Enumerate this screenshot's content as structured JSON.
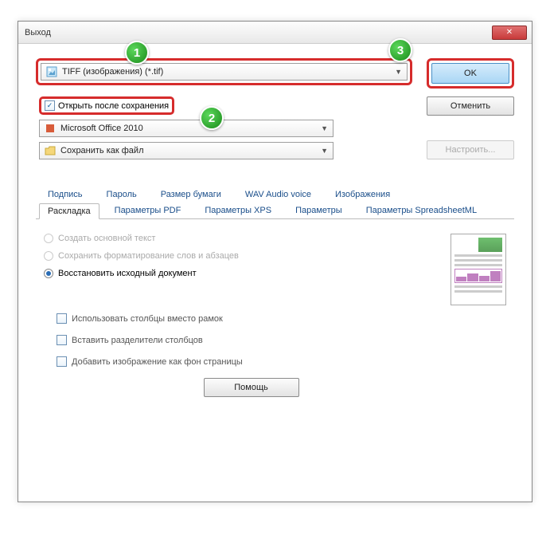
{
  "window": {
    "title": "Выход"
  },
  "markers": {
    "m1": "1",
    "m2": "2",
    "m3": "3"
  },
  "dropdowns": {
    "format": "TIFF (изображения) (*.tif)",
    "app": "Microsoft Office 2010",
    "save": "Сохранить как файл"
  },
  "buttons": {
    "ok": "OK",
    "cancel": "Отменить",
    "configure": "Настроить...",
    "help": "Помощь"
  },
  "checkboxes": {
    "open_after": "Открыть после сохранения",
    "use_columns": "Использовать столбцы вместо рамок",
    "col_dividers": "Вставить разделители столбцов",
    "add_bg_image": "Добавить изображение как фон страницы"
  },
  "tabs_row1": {
    "signature": "Подпись",
    "password": "Пароль",
    "paper": "Размер бумаги",
    "wav": "WAV Audio voice",
    "images": "Изображения"
  },
  "tabs_row2": {
    "layout": "Раскладка",
    "pdf": "Параметры PDF",
    "xps": "Параметры XPS",
    "params": "Параметры",
    "spread": "Параметры SpreadsheetML"
  },
  "radios": {
    "r1": "Создать основной текст",
    "r2": "Сохранить форматирование слов и абзацев",
    "r3": "Восстановить исходный документ"
  }
}
